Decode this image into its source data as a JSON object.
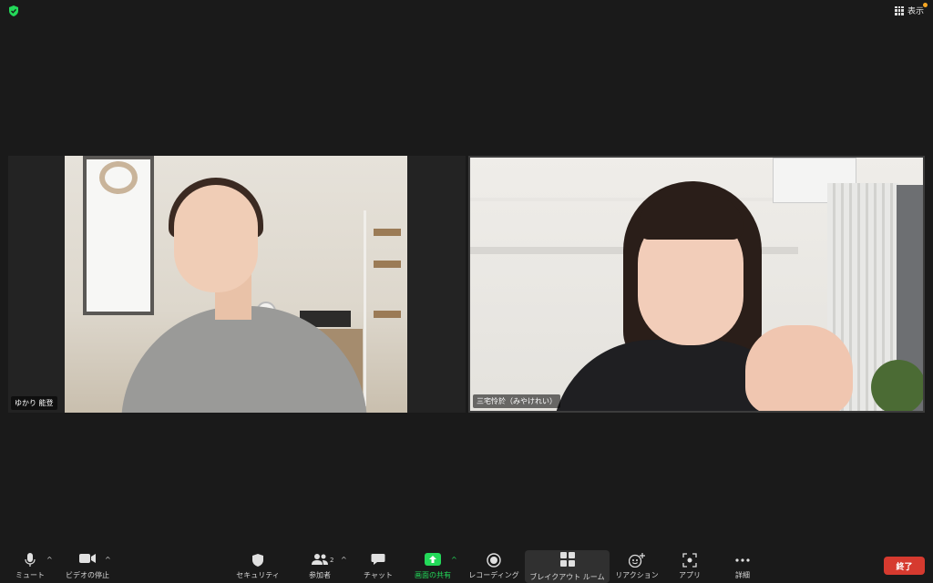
{
  "top": {
    "view_label": "表示",
    "shield_icon": "shield-check-icon",
    "accent_green": "#23d959",
    "notification_color": "#f5a623"
  },
  "participants": [
    {
      "name": "ゆかり 能登"
    },
    {
      "name": "三宅怜於（みやけれい）"
    }
  ],
  "toolbar": {
    "mute": {
      "label": "ミュート",
      "icon": "microphone-icon"
    },
    "video": {
      "label": "ビデオの停止",
      "icon": "video-camera-icon"
    },
    "security": {
      "label": "セキュリティ",
      "icon": "shield-icon"
    },
    "participants": {
      "label": "参加者",
      "count": "2",
      "icon": "people-icon"
    },
    "chat": {
      "label": "チャット",
      "icon": "chat-bubble-icon"
    },
    "share": {
      "label": "画面の共有",
      "icon": "share-screen-icon"
    },
    "record": {
      "label": "レコーディング",
      "icon": "record-icon"
    },
    "breakout": {
      "label": "ブレイクアウト ルーム",
      "icon": "breakout-rooms-icon"
    },
    "reactions": {
      "label": "リアクション",
      "icon": "emoji-plus-icon"
    },
    "apps": {
      "label": "アプリ",
      "icon": "apps-icon"
    },
    "more": {
      "label": "詳細",
      "icon": "more-dots-icon"
    },
    "end": {
      "label": "終了",
      "color": "#d63a2f"
    }
  }
}
